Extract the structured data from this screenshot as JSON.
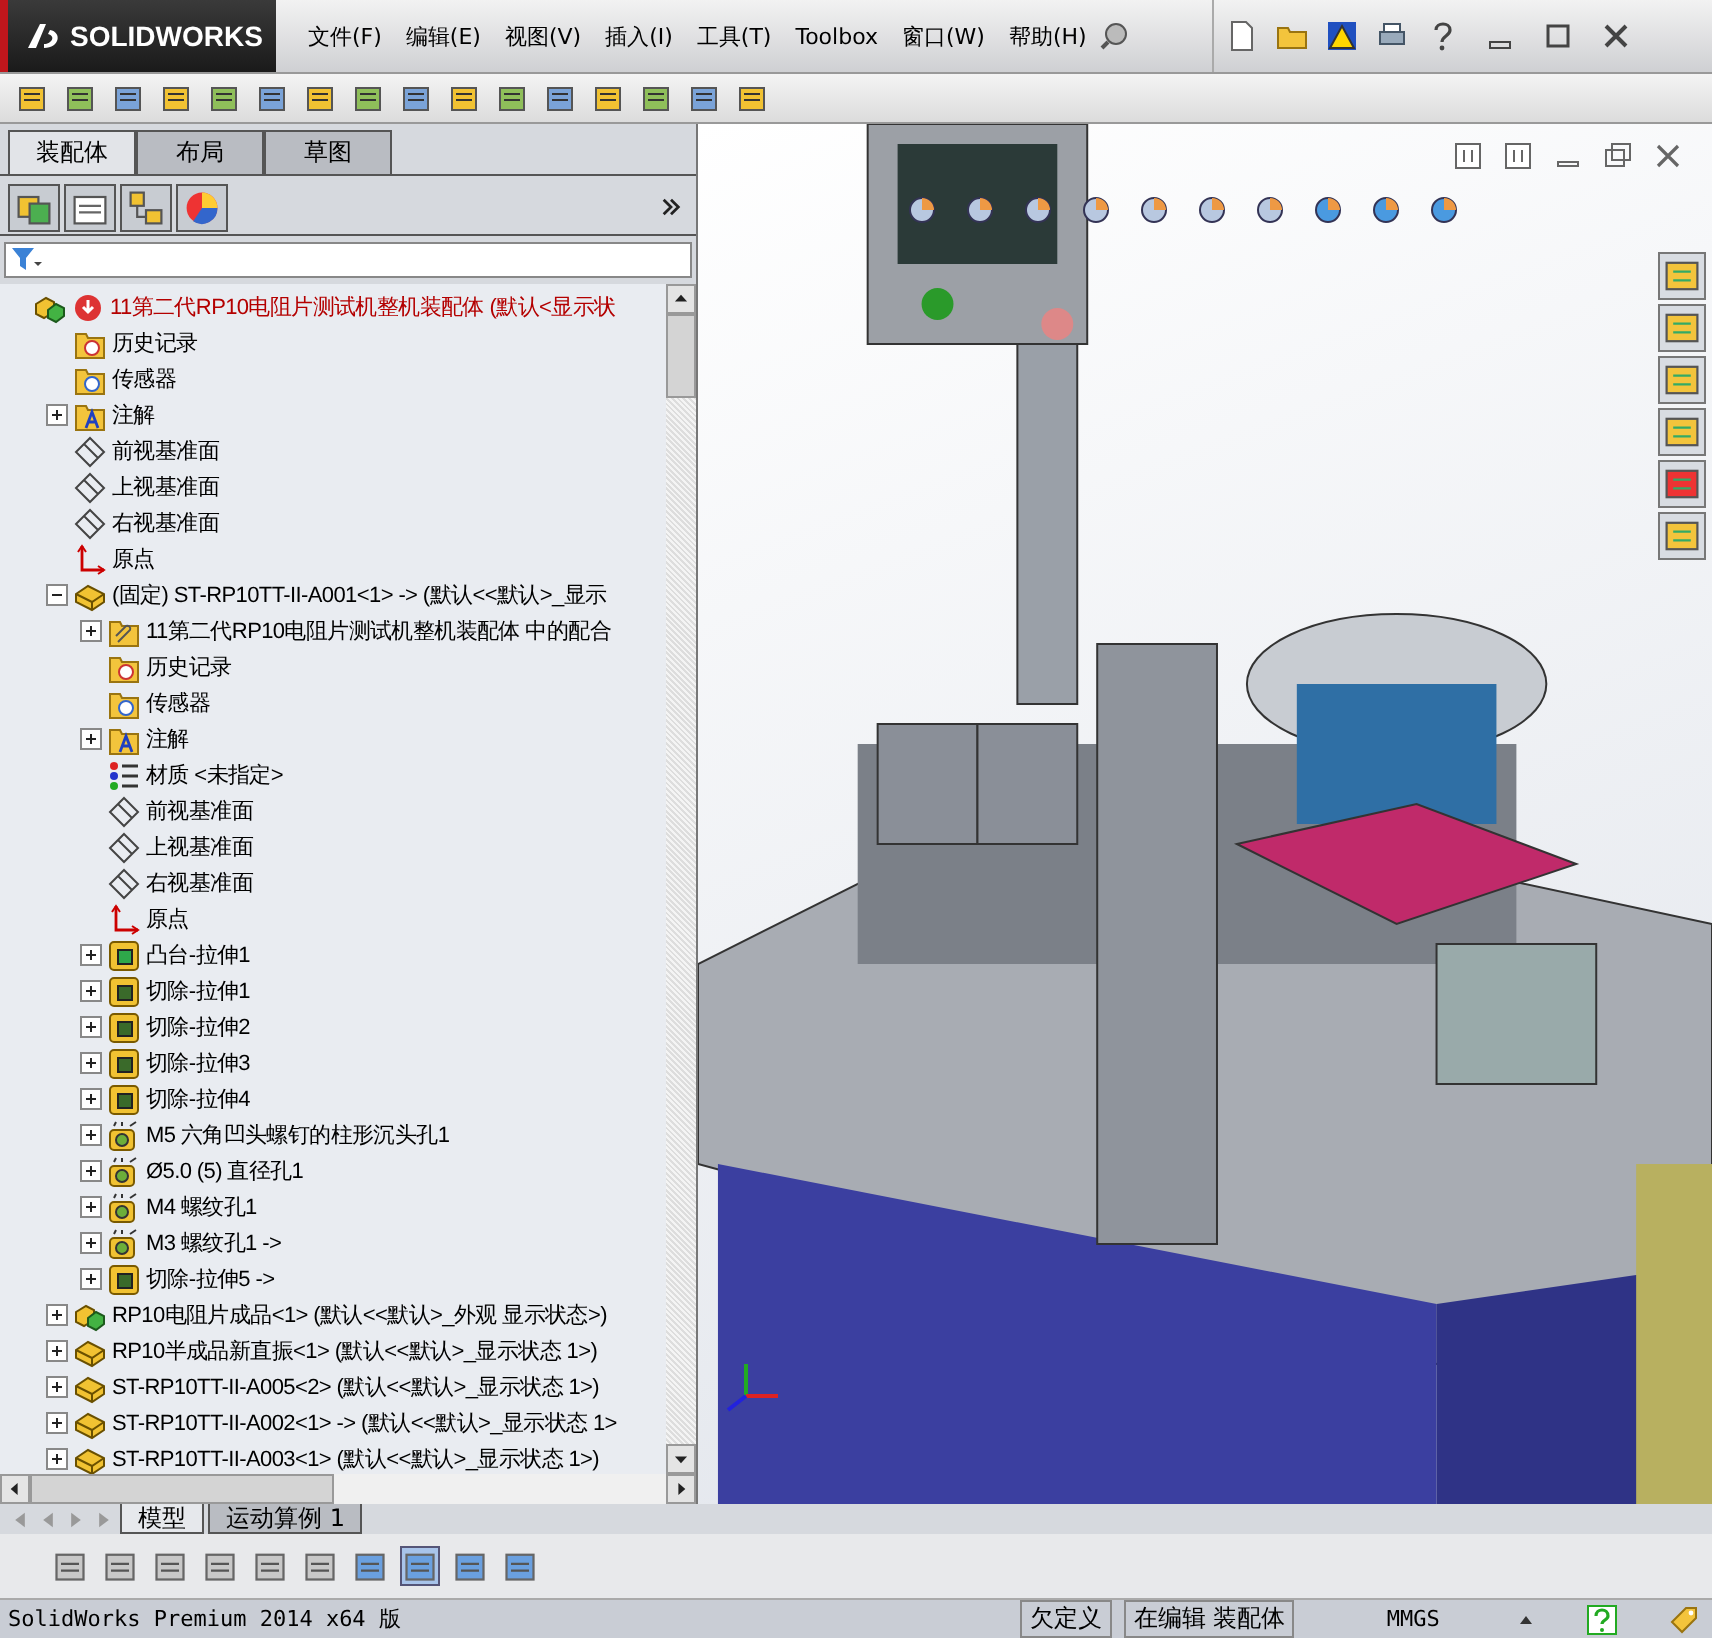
{
  "app": {
    "logo_text": "SOLIDWORKS"
  },
  "menu": [
    "文件(F)",
    "编辑(E)",
    "视图(V)",
    "插入(I)",
    "工具(T)",
    "Toolbox",
    "窗口(W)",
    "帮助(H)"
  ],
  "panel_tabs": [
    {
      "label": "装配体",
      "selected": true
    },
    {
      "label": "布局",
      "selected": false
    },
    {
      "label": "草图",
      "selected": false
    }
  ],
  "tree": {
    "items": [
      {
        "label": "11第二代RP10电阻片测试机整机装配体  (默认<显示状",
        "kind": "assembly",
        "warning": true,
        "children": [
          {
            "label": "历史记录",
            "kind": "history"
          },
          {
            "label": "传感器",
            "kind": "sensor"
          },
          {
            "label": "注解",
            "kind": "annotation",
            "expanded": false
          },
          {
            "label": "前视基准面",
            "kind": "plane"
          },
          {
            "label": "上视基准面",
            "kind": "plane"
          },
          {
            "label": "右视基准面",
            "kind": "plane"
          },
          {
            "label": "原点",
            "kind": "origin"
          },
          {
            "label": "(固定) ST-RP10TT-II-A001<1> -> (默认<<默认>_显示",
            "kind": "part",
            "expanded": true,
            "children": [
              {
                "label": "11第二代RP10电阻片测试机整机装配体 中的配合",
                "kind": "mates",
                "expanded": false
              },
              {
                "label": "历史记录",
                "kind": "history"
              },
              {
                "label": "传感器",
                "kind": "sensor"
              },
              {
                "label": "注解",
                "kind": "annotation",
                "expanded": false
              },
              {
                "label": "材质 <未指定>",
                "kind": "material"
              },
              {
                "label": "前视基准面",
                "kind": "plane"
              },
              {
                "label": "上视基准面",
                "kind": "plane"
              },
              {
                "label": "右视基准面",
                "kind": "plane"
              },
              {
                "label": "原点",
                "kind": "origin"
              },
              {
                "label": "凸台-拉伸1",
                "kind": "boss",
                "expanded": false
              },
              {
                "label": "切除-拉伸1",
                "kind": "cut",
                "expanded": false
              },
              {
                "label": "切除-拉伸2",
                "kind": "cut",
                "expanded": false
              },
              {
                "label": "切除-拉伸3",
                "kind": "cut",
                "expanded": false
              },
              {
                "label": "切除-拉伸4",
                "kind": "cut",
                "expanded": false
              },
              {
                "label": "M5 六角凹头螺钉的柱形沉头孔1",
                "kind": "hole",
                "expanded": false
              },
              {
                "label": "Ø5.0 (5) 直径孔1",
                "kind": "hole",
                "expanded": false
              },
              {
                "label": "M4 螺纹孔1",
                "kind": "hole",
                "expanded": false
              },
              {
                "label": "M3 螺纹孔1 ->",
                "kind": "hole",
                "expanded": false
              },
              {
                "label": "切除-拉伸5 ->",
                "kind": "cut",
                "expanded": false
              }
            ]
          },
          {
            "label": "RP10电阻片成品<1> (默认<<默认>_外观 显示状态>)",
            "kind": "assembly",
            "expanded": false
          },
          {
            "label": "RP10半成品新直振<1> (默认<<默认>_显示状态 1>)",
            "kind": "part",
            "expanded": false
          },
          {
            "label": "ST-RP10TT-II-A005<2> (默认<<默认>_显示状态 1>)",
            "kind": "part",
            "expanded": false
          },
          {
            "label": "ST-RP10TT-II-A002<1> -> (默认<<默认>_显示状态 1>",
            "kind": "part",
            "expanded": false
          },
          {
            "label": "ST-RP10TT-II-A003<1> (默认<<默认>_显示状态 1>)",
            "kind": "part",
            "expanded": false
          }
        ]
      }
    ]
  },
  "bottom_tabs": [
    {
      "label": "模型",
      "selected": true
    },
    {
      "label": "运动算例 1",
      "selected": false
    }
  ],
  "status_bar": {
    "product": "SolidWorks Premium 2014 x64 版",
    "definition": "欠定义",
    "mode": "在编辑 装配体",
    "units": "MMGS"
  }
}
